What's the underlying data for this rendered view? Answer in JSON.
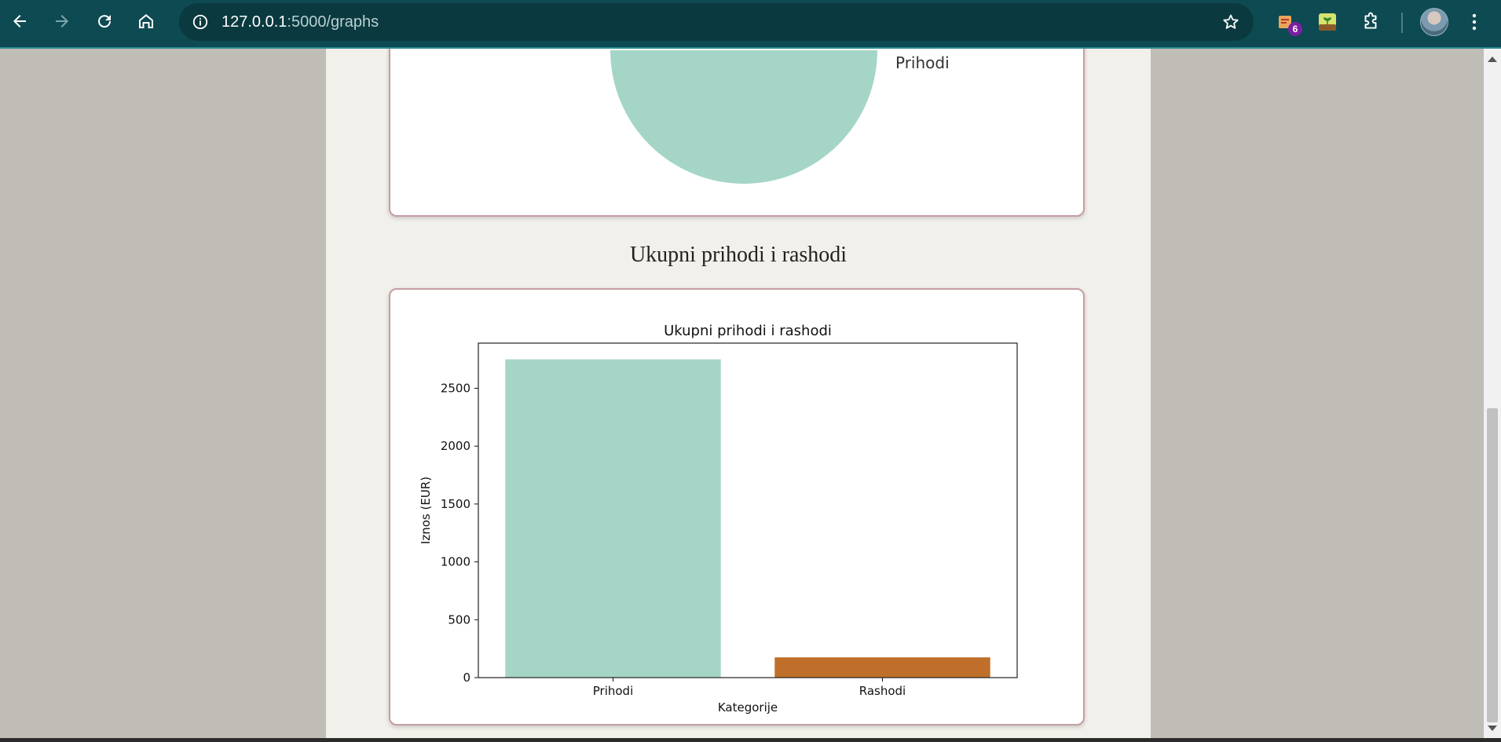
{
  "browser": {
    "url_host": "127.0.0.1",
    "url_rest": ":5000/graphs",
    "extension_badge": "6",
    "icons": [
      "back-arrow-icon",
      "forward-arrow-icon",
      "reload-icon",
      "home-icon",
      "site-info-icon",
      "bookmark-star-icon",
      "extension-icon",
      "puzzle-icon",
      "kebab-menu-icon"
    ]
  },
  "pie_chart": {
    "legend_label": "Prihodi",
    "color": "#a5d5c6"
  },
  "section": {
    "title": "Ukupni prihodi i rashodi"
  },
  "chart_data": {
    "type": "bar",
    "title": "Ukupni prihodi i rashodi",
    "xlabel": "Kategorije",
    "ylabel": "Iznos (EUR)",
    "categories": [
      "Prihodi",
      "Rashodi"
    ],
    "values": [
      2750,
      175
    ],
    "colors": [
      "#a5d5c6",
      "#bf6f2a"
    ],
    "ylim": [
      0,
      2890
    ],
    "yticks": [
      0,
      500,
      1000,
      1500,
      2000,
      2500
    ],
    "grid": false
  }
}
